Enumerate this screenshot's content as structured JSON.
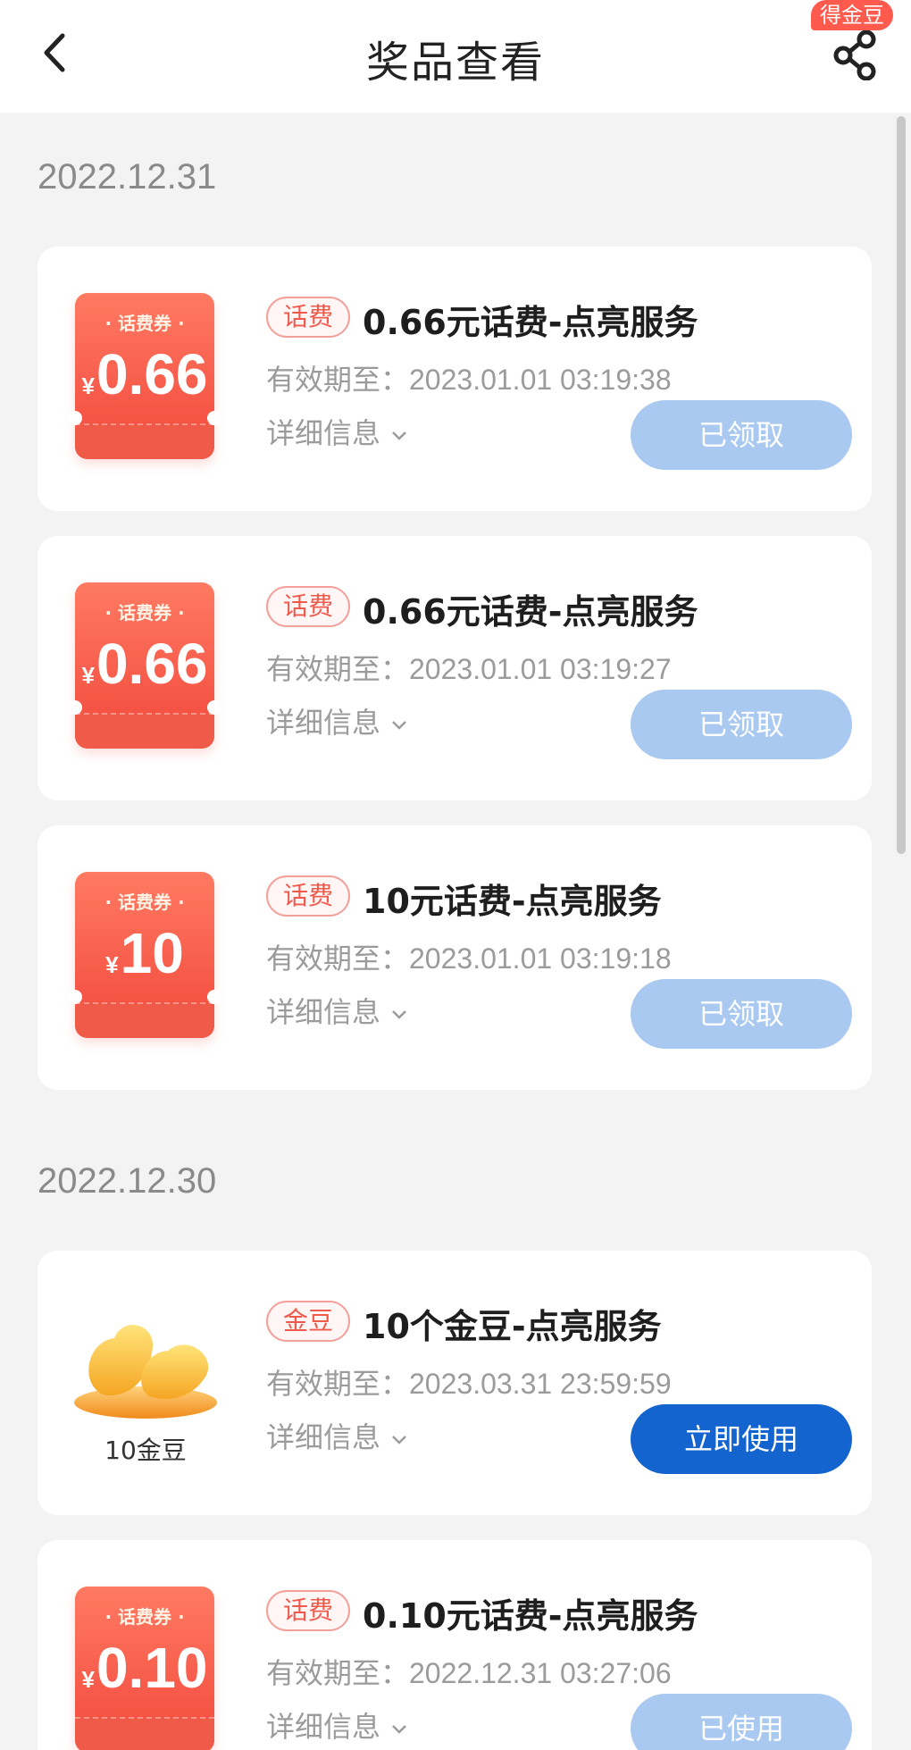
{
  "header": {
    "title": "奖品查看",
    "badge": "得金豆"
  },
  "groups": [
    {
      "date": "2022.12.31",
      "items": [
        {
          "coupon_label": "· 话费券 ·",
          "yen": "¥",
          "amount": "0.66",
          "tag": "话费",
          "title": "0.66元话费-点亮服务",
          "expiry": "有效期至：2023.01.01 03:19:38",
          "details": "详细信息",
          "button": "已领取",
          "button_state": "claimed"
        },
        {
          "coupon_label": "· 话费券 ·",
          "yen": "¥",
          "amount": "0.66",
          "tag": "话费",
          "title": "0.66元话费-点亮服务",
          "expiry": "有效期至：2023.01.01 03:19:27",
          "details": "详细信息",
          "button": "已领取",
          "button_state": "claimed"
        },
        {
          "coupon_label": "· 话费券 ·",
          "yen": "¥",
          "amount": "10",
          "tag": "话费",
          "title": "10元话费-点亮服务",
          "expiry": "有效期至：2023.01.01 03:19:18",
          "details": "详细信息",
          "button": "已领取",
          "button_state": "claimed"
        }
      ]
    },
    {
      "date": "2022.12.30",
      "items": [
        {
          "image": "gold-beans",
          "caption": "10金豆",
          "tag": "金豆",
          "title": "10个金豆-点亮服务",
          "expiry": "有效期至：2023.03.31 23:59:59",
          "details": "详细信息",
          "button": "立即使用",
          "button_state": "active"
        },
        {
          "coupon_label": "· 话费券 ·",
          "yen": "¥",
          "amount": "0.10",
          "tag": "话费",
          "title": "0.10元话费-点亮服务",
          "expiry": "有效期至：2022.12.31 03:27:06",
          "details": "详细信息",
          "button": "已使用",
          "button_state": "used"
        }
      ]
    }
  ],
  "colors": {
    "accent_blue": "#1464d0",
    "disabled_blue": "#a9c9f0",
    "coupon_red": "#f2483c",
    "tag_red": "#ef5a4c"
  },
  "icons": [
    "back-arrow-icon",
    "share-icon",
    "chevron-down-icon",
    "gold-beans-icon"
  ]
}
